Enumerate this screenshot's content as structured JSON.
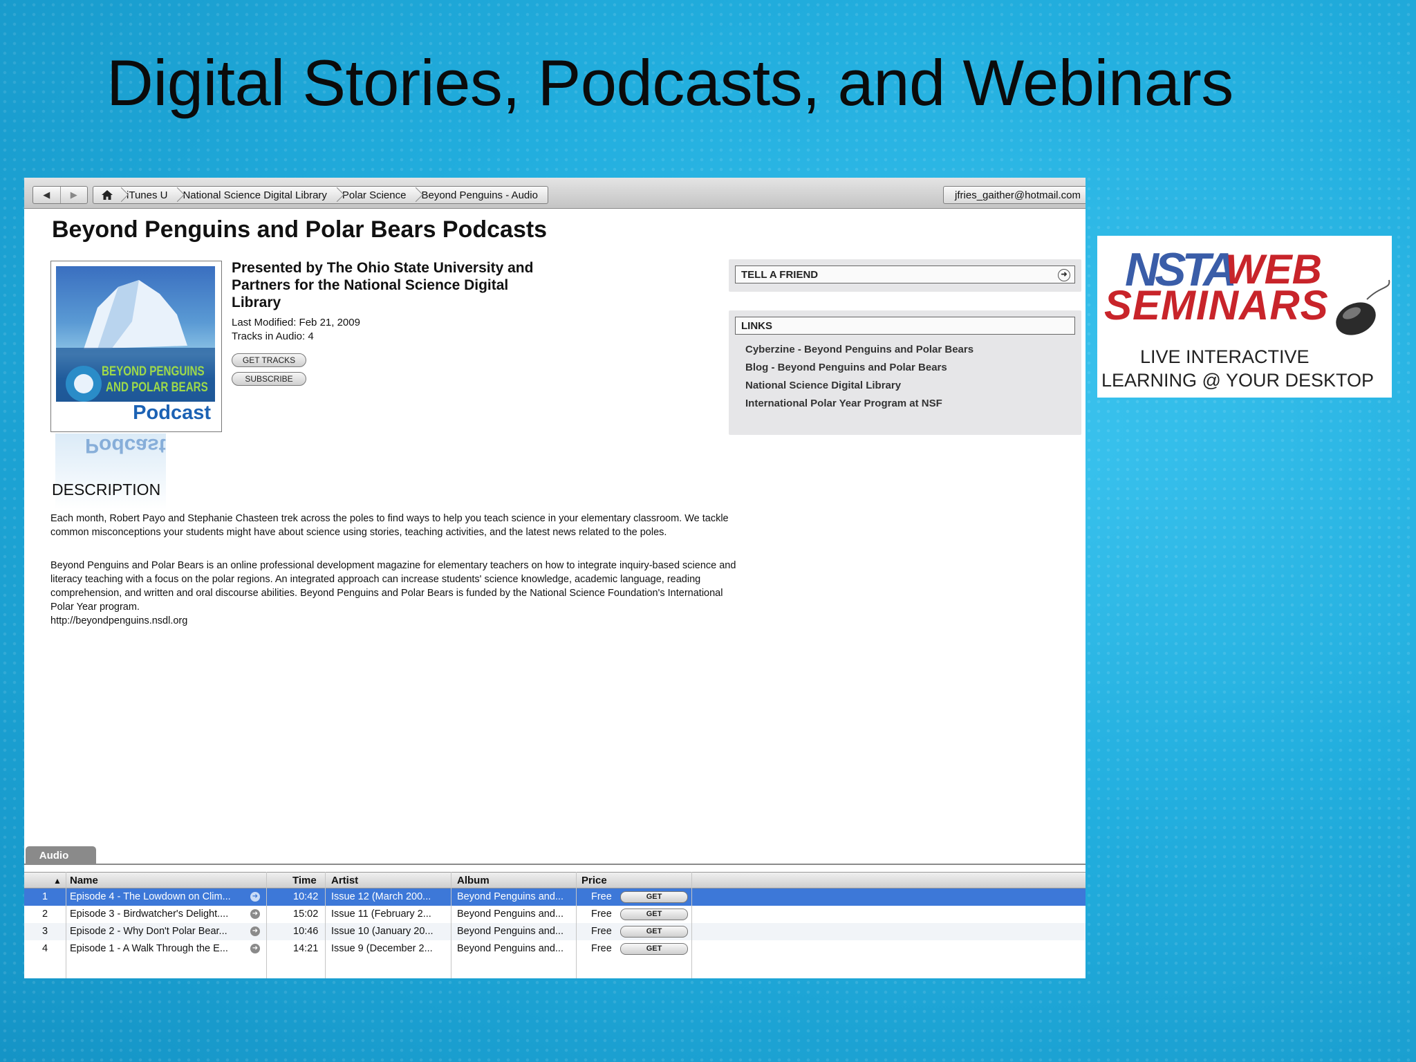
{
  "slide": {
    "title": "Digital Stories, Podcasts, and Webinars"
  },
  "toolbar": {
    "breadcrumbs": [
      "iTunes U",
      "National Science Digital Library",
      "Polar Science",
      "Beyond Penguins - Audio"
    ],
    "account": "jfries_gaither@hotmail.com"
  },
  "page": {
    "heading": "Beyond Penguins and Polar Bears Podcasts",
    "artwork_text": {
      "line1": "BEYOND PENGUINS",
      "line2": "AND POLAR BEARS",
      "line3": "Podcast"
    },
    "presenter": "Presented by The Ohio State University and Partners for the National Science Digital Library",
    "last_modified": "Last Modified: Feb 21, 2009",
    "tracks": "Tracks in Audio: 4",
    "get_tracks": "GET TRACKS",
    "subscribe": "SUBSCRIBE"
  },
  "tell_friend": {
    "label": "TELL A FRIEND"
  },
  "links": {
    "label": "LINKS",
    "items": [
      "Cyberzine - Beyond Penguins and Polar Bears",
      "Blog - Beyond Penguins and Polar Bears",
      "National Science Digital Library",
      "International Polar Year Program at NSF"
    ]
  },
  "description": {
    "heading": "DESCRIPTION",
    "p1": "Each month, Robert Payo and Stephanie Chasteen trek across the poles to find ways to help you teach science in your elementary classroom. We tackle common misconceptions your students might have about science using stories, teaching activities, and the latest news related to the poles.",
    "p2": "Beyond Penguins and Polar Bears is an online professional development magazine for elementary teachers on how to integrate inquiry-based science and literacy teaching with a focus on the polar regions. An integrated approach can increase students' science knowledge, academic language, reading comprehension, and written and oral discourse abilities. Beyond Penguins and Polar Bears is funded by the National Science Foundation's International Polar Year program.",
    "url": "http://beyondpenguins.nsdl.org"
  },
  "tracklist": {
    "tab": "Audio",
    "columns": {
      "name": "Name",
      "time": "Time",
      "artist": "Artist",
      "album": "Album",
      "price": "Price"
    },
    "get_label": "GET",
    "rows": [
      {
        "num": "1",
        "name": "Episode 4 - The Lowdown on Clim...",
        "time": "10:42",
        "artist": "Issue 12 (March 200...",
        "album": "Beyond Penguins and...",
        "price": "Free"
      },
      {
        "num": "2",
        "name": "Episode 3 - Birdwatcher's Delight....",
        "time": "15:02",
        "artist": "Issue 11 (February 2...",
        "album": "Beyond Penguins and...",
        "price": "Free"
      },
      {
        "num": "3",
        "name": "Episode 2 - Why Don't Polar Bear...",
        "time": "10:46",
        "artist": "Issue 10 (January 20...",
        "album": "Beyond Penguins and...",
        "price": "Free"
      },
      {
        "num": "4",
        "name": "Episode 1 - A Walk Through the E...",
        "time": "14:21",
        "artist": "Issue 9 (December 2...",
        "album": "Beyond Penguins and...",
        "price": "Free"
      }
    ]
  },
  "logo": {
    "nsta": "NSTA",
    "web": "WEB",
    "seminars": "SEMINARS",
    "tagline1": "LIVE INTERACTIVE",
    "tagline2": "LEARNING @ YOUR DESKTOP"
  }
}
